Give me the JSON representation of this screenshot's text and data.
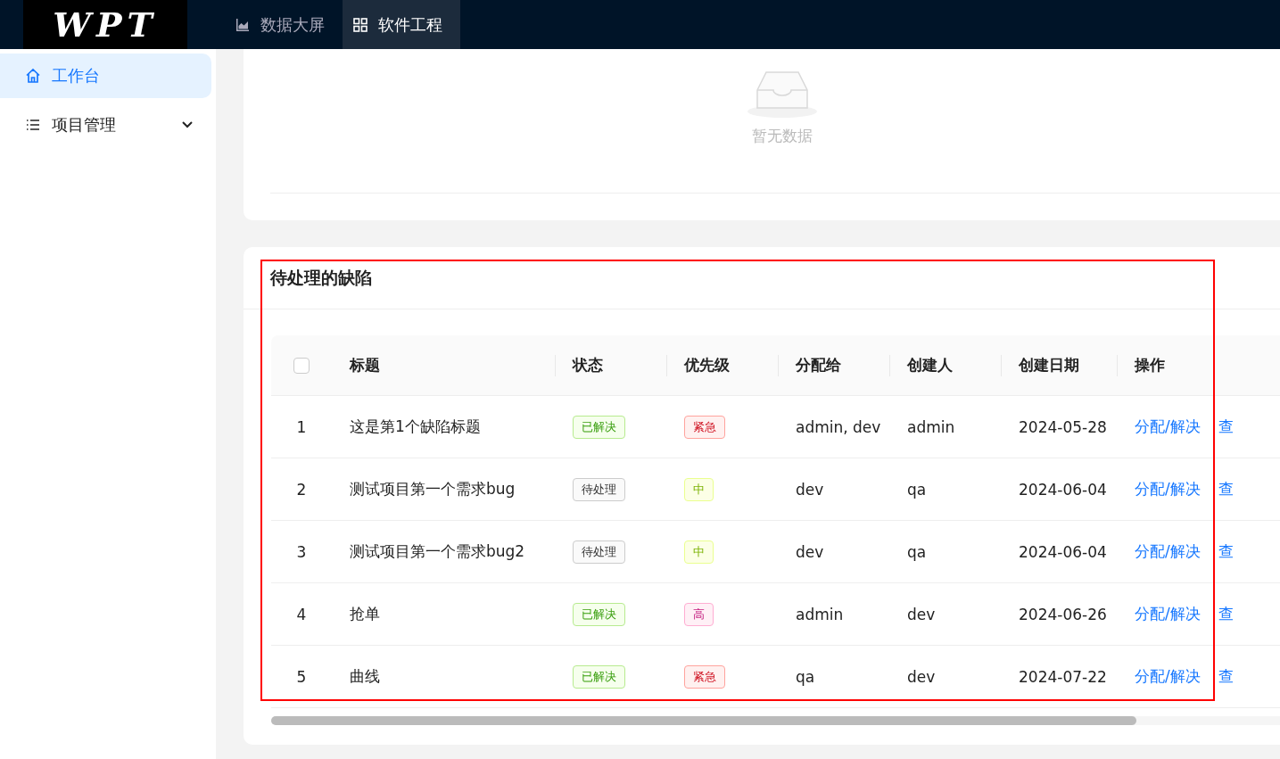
{
  "header": {
    "logo": "WPT",
    "nav": [
      {
        "label": "数据大屏",
        "selected": false
      },
      {
        "label": "软件工程",
        "selected": true
      }
    ]
  },
  "sidebar": {
    "items": [
      {
        "label": "工作台",
        "selected": true
      },
      {
        "label": "项目管理",
        "selected": false,
        "expanded": false
      }
    ]
  },
  "empty_card": {
    "message": "暂无数据"
  },
  "defects_card": {
    "title": "待处理的缺陷",
    "select_all_checked": false,
    "columns": [
      "标题",
      "状态",
      "优先级",
      "分配给",
      "创建人",
      "创建日期",
      "操作"
    ],
    "rows": [
      {
        "index": "1",
        "title": "这是第1个缺陷标题",
        "status": {
          "label": "已解决",
          "kind": "resolved"
        },
        "priority": {
          "label": "紧急",
          "kind": "urgent"
        },
        "assignee": "admin, dev",
        "creator": "admin",
        "date": "2024-05-28",
        "actions": [
          "分配/解决",
          "查"
        ]
      },
      {
        "index": "2",
        "title": "测试项目第一个需求bug",
        "status": {
          "label": "待处理",
          "kind": "pending"
        },
        "priority": {
          "label": "中",
          "kind": "medium"
        },
        "assignee": "dev",
        "creator": "qa",
        "date": "2024-06-04",
        "actions": [
          "分配/解决",
          "查"
        ]
      },
      {
        "index": "3",
        "title": "测试项目第一个需求bug2",
        "status": {
          "label": "待处理",
          "kind": "pending"
        },
        "priority": {
          "label": "中",
          "kind": "medium"
        },
        "assignee": "dev",
        "creator": "qa",
        "date": "2024-06-04",
        "actions": [
          "分配/解决",
          "查"
        ]
      },
      {
        "index": "4",
        "title": "抢单",
        "status": {
          "label": "已解决",
          "kind": "resolved"
        },
        "priority": {
          "label": "高",
          "kind": "high"
        },
        "assignee": "admin",
        "creator": "dev",
        "date": "2024-06-26",
        "actions": [
          "分配/解决",
          "查"
        ]
      },
      {
        "index": "5",
        "title": "曲线",
        "status": {
          "label": "已解决",
          "kind": "resolved"
        },
        "priority": {
          "label": "紧急",
          "kind": "urgent"
        },
        "assignee": "qa",
        "creator": "dev",
        "date": "2024-07-22",
        "actions": [
          "分配/解决",
          "查"
        ]
      }
    ]
  }
}
